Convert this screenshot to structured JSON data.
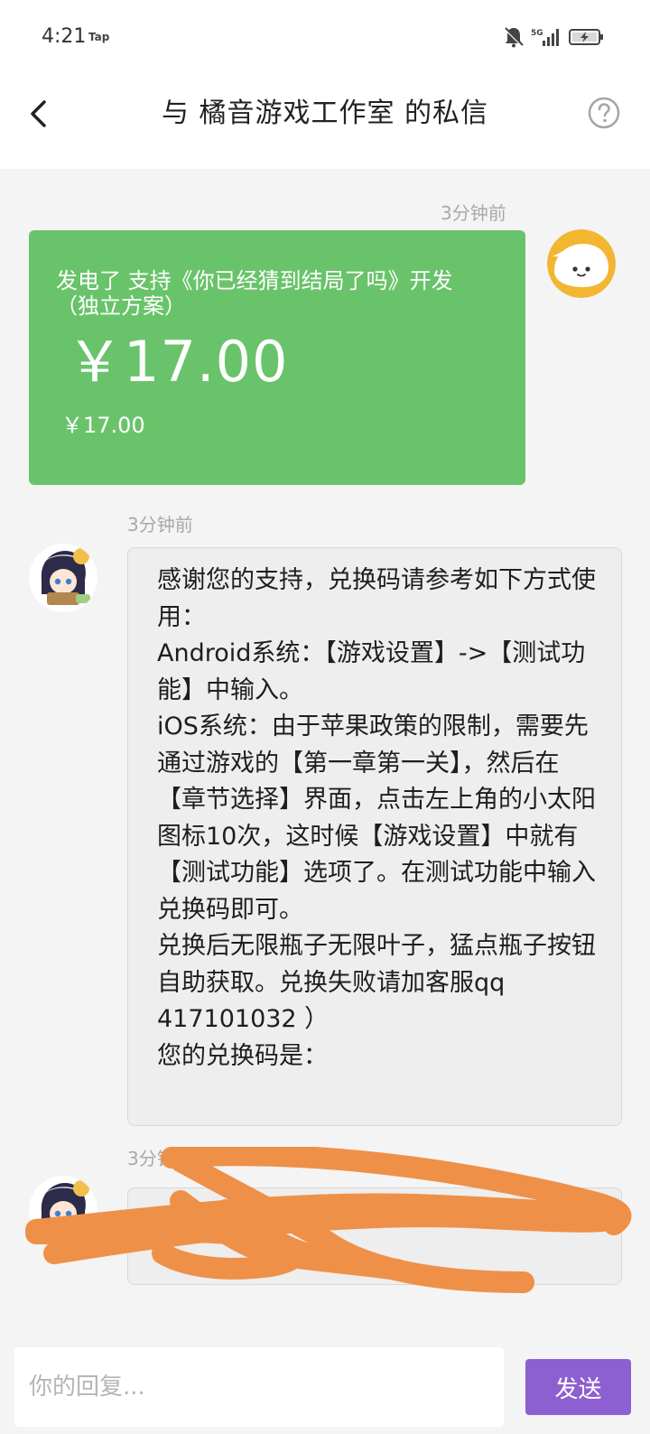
{
  "status_bar": {
    "time": "4:21",
    "carrier_tag": "Tap",
    "network": "5G",
    "icons": [
      "bell-off-icon",
      "signal-icon",
      "battery-charging-icon"
    ]
  },
  "header": {
    "title": "与 橘音游戏工作室 的私信",
    "back_icon": "chevron-left-icon",
    "help_icon": "question-circle-icon"
  },
  "messages": [
    {
      "timestamp": "3分钟前",
      "sender": "self",
      "type": "power_card",
      "description": "发电了 支持《你已经猜到结局了吗》开发 （独立方案）",
      "amount": "￥17.00",
      "sub_amount": "￥17.00",
      "card_color": "#69c36a"
    },
    {
      "timestamp": "3分钟前",
      "sender": "studio",
      "type": "text",
      "text": "感谢您的支持，兑换码请参考如下方式使用：\nAndroid系统：【游戏设置】->【测试功能】中输入。\niOS系统：由于苹果政策的限制，需要先通过游戏的【第一章第一关】，然后在【章节选择】界面，点击左上角的小太阳图标10次，这时候【游戏设置】中就有【测试功能】选项了。在测试功能中输入兑换码即可。\n兑换后无限瓶子无限叶子，猛点瓶子按钮自助获取。兑换失败请加客服qq 417101032 ）\n您的兑换码是："
    },
    {
      "timestamp": "3分钟前",
      "sender": "studio",
      "type": "text",
      "text": ""
    }
  ],
  "reply": {
    "placeholder": "你的回复...",
    "value": "",
    "send_label": "发送",
    "accent": "#8d5fd0"
  }
}
